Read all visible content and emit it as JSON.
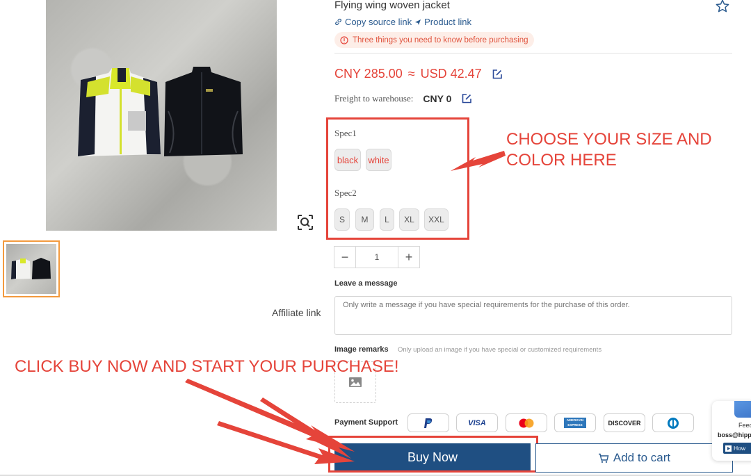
{
  "product": {
    "title": "Flying wing woven jacket",
    "copy_source_link": "Copy source link",
    "product_link": "Product link",
    "notice": "Three things you need to know before purchasing",
    "price_cny": "CNY 285.00",
    "approx": "≈",
    "price_usd": "USD 42.47",
    "freight_label": "Freight to warehouse:",
    "freight_value": "CNY 0"
  },
  "specs": {
    "spec1_label": "Spec1",
    "spec1_options": [
      "black",
      "white"
    ],
    "spec2_label": "Spec2",
    "spec2_options": [
      "S",
      "M",
      "L",
      "XL",
      "XXL"
    ]
  },
  "quantity": {
    "minus": "−",
    "value": "1",
    "plus": "+"
  },
  "message": {
    "label": "Leave a message",
    "placeholder": "Only write a message if you have special requirements for the purchase of this order."
  },
  "affiliate_link": "Affiliate link",
  "image_remarks": {
    "label": "Image remarks",
    "hint": "Only upload an image if you have special or customized requirements"
  },
  "payment": {
    "label": "Payment Support",
    "methods": [
      "PayPal",
      "VISA",
      "Mastercard",
      "AMERICAN EXPRESS",
      "DISCOVER",
      "Diners Club"
    ]
  },
  "actions": {
    "buy_now": "Buy Now",
    "add_to_cart": "Add to cart"
  },
  "annotations": {
    "choose_line1": "CHOOSE YOUR SIZE AND",
    "choose_line2": "COLOR HERE",
    "click_buy": "CLICK BUY NOW AND START YOUR PURCHASE!"
  },
  "feedback_widget": {
    "label": "Feed",
    "email": "boss@hipp",
    "button": "How"
  },
  "colors": {
    "accent_red": "#e5443a",
    "brand_blue": "#1f4f82",
    "link_blue": "#2b5b8f",
    "thumb_border": "#f39a3e"
  },
  "icons": [
    "star-icon",
    "link-icon",
    "send-icon",
    "info-icon",
    "edit-icon",
    "zoom-scan-icon",
    "image-icon",
    "cart-icon",
    "play-icon"
  ]
}
